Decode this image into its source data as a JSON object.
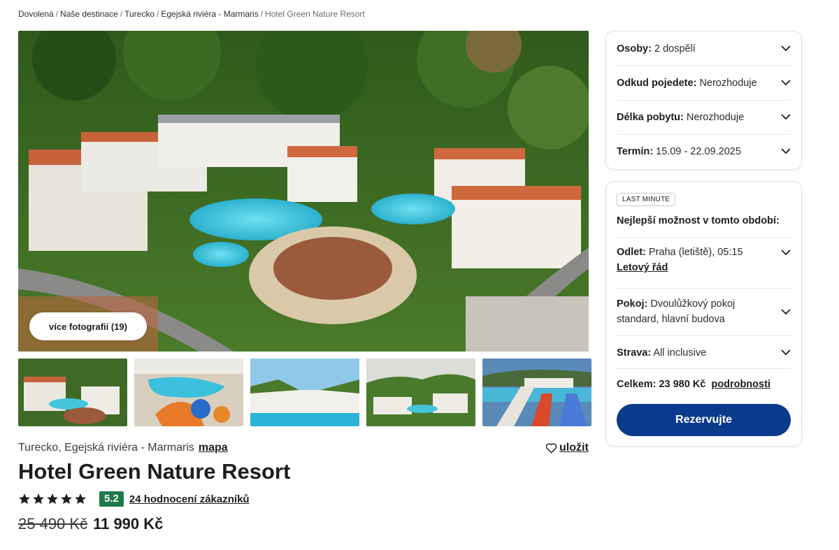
{
  "breadcrumb": {
    "items": [
      "Dovolená",
      "Naše destinace",
      "Turecko",
      "Egejská riviéra - Marmaris"
    ],
    "current": "Hotel Green Nature Resort",
    "separator": "/"
  },
  "gallery": {
    "more_photos_label": "více fotografií (19)",
    "thumbnail_count": 5
  },
  "hotel": {
    "location": "Turecko, Egejská riviéra - Marmaris",
    "map_label": "mapa",
    "save_label": "uložit",
    "name": "Hotel Green Nature Resort",
    "stars": 5,
    "score": "5.2",
    "reviews_label": "24 hodnocení zákazníků",
    "old_price": "25 490 Kč",
    "price": "11 990 Kč"
  },
  "search": {
    "persons": {
      "label": "Osoby:",
      "value": "2 dospělí"
    },
    "departure_from": {
      "label": "Odkud pojedete:",
      "value": "Nerozhoduje"
    },
    "length": {
      "label": "Délka pobytu:",
      "value": "Nerozhoduje"
    },
    "date": {
      "label": "Termín:",
      "value": "15.09 - 22.09.2025"
    }
  },
  "offer": {
    "badge": "LAST MINUTE",
    "heading": "Nejlepší možnost v tomto období:",
    "flight": {
      "label": "Odlet:",
      "value": "Praha (letiště), 05:15",
      "link": "Letový řád"
    },
    "room": {
      "label": "Pokoj:",
      "value": "Dvoulůžkový pokoj standard, hlavní budova"
    },
    "board": {
      "label": "Strava:",
      "value": "All inclusive"
    },
    "total": {
      "label": "Celkem:",
      "value": "23 980 Kč",
      "details_label": "podrobnosti"
    },
    "reserve_label": "Rezervujte"
  },
  "colors": {
    "primary_button": "#0a3a8c",
    "score_badge": "#1f7a4a"
  }
}
